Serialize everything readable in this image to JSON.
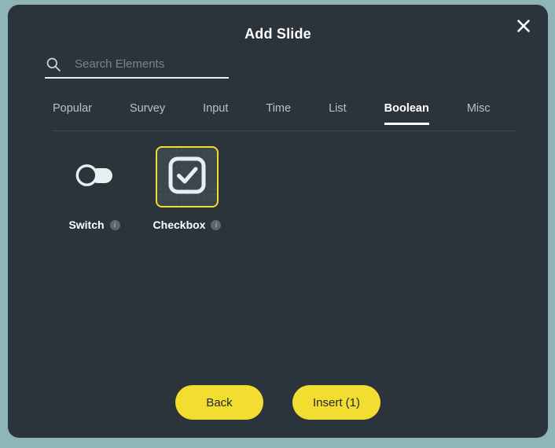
{
  "dialog": {
    "title": "Add Slide",
    "close_label": "close-icon"
  },
  "search": {
    "placeholder": "Search Elements",
    "value": "",
    "icon": "search-icon"
  },
  "tabs": [
    {
      "label": "Popular",
      "active": false
    },
    {
      "label": "Survey",
      "active": false
    },
    {
      "label": "Input",
      "active": false
    },
    {
      "label": "Time",
      "active": false
    },
    {
      "label": "List",
      "active": false
    },
    {
      "label": "Boolean",
      "active": true
    },
    {
      "label": "Misc",
      "active": false
    }
  ],
  "elements": [
    {
      "label": "Switch",
      "icon": "switch-icon",
      "selected": false,
      "info": "i"
    },
    {
      "label": "Checkbox",
      "icon": "checkbox-icon",
      "selected": true,
      "info": "i"
    }
  ],
  "footer": {
    "back_label": "Back",
    "insert_label": "Insert (1)"
  },
  "colors": {
    "page_background": "#8fb5b8",
    "modal_background": "#2b343b",
    "accent_yellow": "#f2dd2e",
    "text_primary": "#ffffff",
    "text_muted": "#b7c1c6"
  }
}
